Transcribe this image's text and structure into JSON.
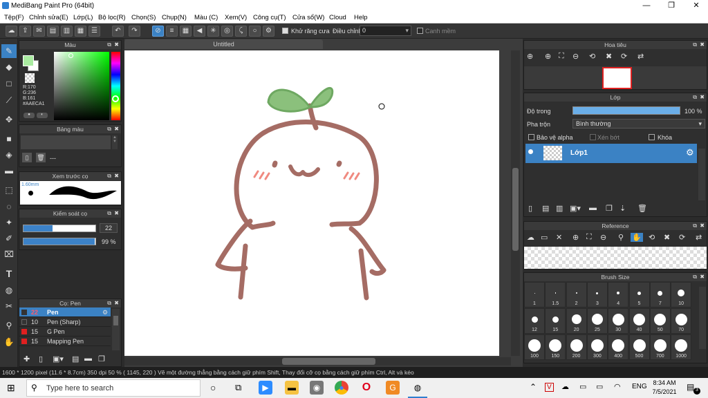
{
  "window": {
    "title": "MediBang Paint Pro (64bit)",
    "min": "—",
    "max": "❐",
    "close": "✕"
  },
  "menu": [
    "Tệp(F)",
    "Chỉnh sửa(E)",
    "Lớp(L)",
    "Bộ lọc(R)",
    "Chọn(S)",
    "Chụp(N)",
    "Màu (C)",
    "Xem(V)",
    "Công cụ(T)",
    "Cửa sổ(W)",
    "Cloud",
    "Help"
  ],
  "toolbar": {
    "antialias_label": "Khử răng cưa",
    "adjust_label": "Điều chỉnh",
    "adjust_value": "0",
    "snap_label": "Canh mềm"
  },
  "color_panel": {
    "title": "Màu",
    "r": "R:170",
    "g": "G:236",
    "b": "B:161",
    "hex": "#AAECA1",
    "current": "#AAECA1"
  },
  "palette_panel": {
    "title": "Bảng màu",
    "dash": "---"
  },
  "preview_panel": {
    "title": "Xem trước cọ",
    "size": "1.60mm"
  },
  "brush_control": {
    "title": "Kiểm soát cọ",
    "size": "22",
    "opacity": "99 %",
    "size_frac": 0.4,
    "opacity_frac": 0.99
  },
  "brush_list": {
    "title": "Cọ: Pen",
    "items": [
      {
        "size": "22",
        "name": "Pen",
        "color": "#333333",
        "selected": true
      },
      {
        "size": "10",
        "name": "Pen (Sharp)",
        "color": "#333333"
      },
      {
        "size": "15",
        "name": "G Pen",
        "color": "#e02020"
      },
      {
        "size": "15",
        "name": "Mapping Pen",
        "color": "#e02020"
      }
    ]
  },
  "canvas": {
    "tab": "Untitled"
  },
  "navigator": {
    "title": "Hoa tiêu"
  },
  "layer_panel": {
    "title": "Lớp",
    "opacity_label": "Độ trong",
    "opacity_value": "100 %",
    "blend_label": "Pha trộn",
    "blend_value": "Bình thường",
    "protect_alpha": "Bảo vệ alpha",
    "clip": "Xén bớt",
    "lock": "Khóa",
    "layer_name": "Lớp1"
  },
  "reference": {
    "title": "Reference"
  },
  "brush_size": {
    "title": "Brush Size",
    "sizes": [
      "1",
      "1.5",
      "2",
      "3",
      "4",
      "5",
      "7",
      "10",
      "12",
      "15",
      "20",
      "25",
      "30",
      "40",
      "50",
      "70",
      "100",
      "150",
      "200",
      "300",
      "400",
      "500",
      "700",
      "1000"
    ]
  },
  "status": {
    "text": "1600 * 1200 pixel   (11.6 * 8.7cm)   350 dpi   50 %   ( 1145, 220 )   Vẽ một đường thẳng bằng cách giữ phím Shift, Thay đổi cỡ cọ bằng cách giữ phím Ctrl, Alt và kéo"
  },
  "taskbar": {
    "search": "Type here to search",
    "time": "8:34 AM",
    "date": "7/5/2021",
    "lang": "ENG",
    "notif": "3"
  }
}
